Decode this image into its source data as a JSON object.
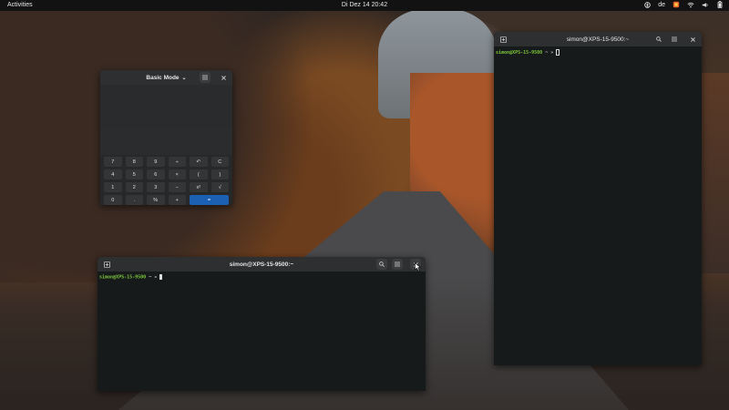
{
  "topbar": {
    "activities": "Activities",
    "clock": "Di Dez 14  20:42",
    "keyboard_layout": "de",
    "icons": [
      "accessibility-icon",
      "firefox-icon",
      "wifi-icon",
      "volume-icon",
      "battery-icon"
    ]
  },
  "calculator": {
    "mode_label": "Basic Mode",
    "keys": [
      "7",
      "8",
      "9",
      "÷",
      "↶",
      "C",
      "4",
      "5",
      "6",
      "×",
      "(",
      ")",
      "1",
      "2",
      "3",
      "−",
      "x²",
      "√",
      "0",
      ".",
      "%",
      "+",
      "="
    ]
  },
  "terminal_main": {
    "title": "simon@XPS-15-9500:~",
    "prompt_user": "simon@XPS-15-9500",
    "prompt_rest": " ~ » "
  },
  "terminal_right": {
    "title": "simon@XPS-15-9500:~",
    "prompt_user": "simon@XPS-15-9500",
    "prompt_rest": " ~ » "
  },
  "colors": {
    "topbar": "#121212",
    "accent": "#1c60b4",
    "prompt_user": "#7cc63b",
    "terminal_bg": "#171a1b"
  }
}
